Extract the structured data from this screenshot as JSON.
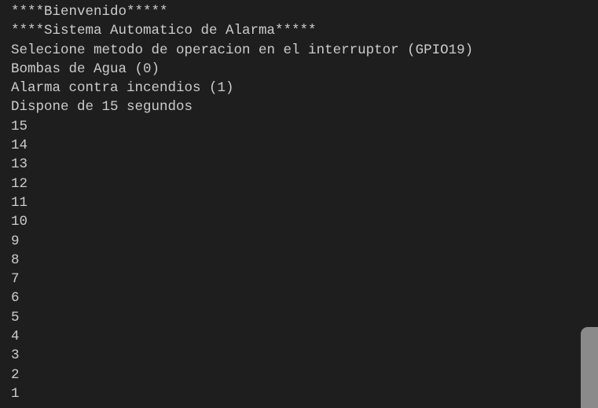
{
  "terminal": {
    "lines": [
      "****Bienvenido*****",
      "****Sistema Automatico de Alarma*****",
      "Selecione metodo de operacion en el interruptor (GPIO19)",
      "Bombas de Agua (0)",
      "Alarma contra incendios (1)",
      "Dispone de 15 segundos",
      "15",
      "14",
      "13",
      "12",
      "11",
      "10",
      "9",
      "8",
      "7",
      "6",
      "5",
      "4",
      "3",
      "2",
      "1"
    ]
  },
  "colors": {
    "background": "#1e1e1e",
    "text": "#cccccc",
    "scrollbar_thumb": "#8a8a8a"
  }
}
